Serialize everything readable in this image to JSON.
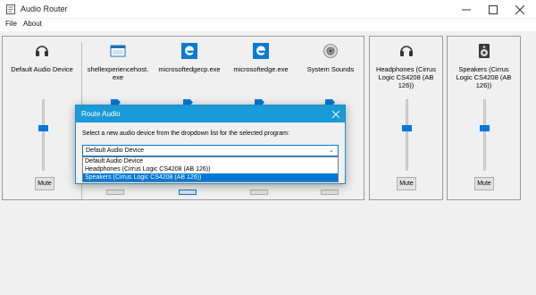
{
  "window": {
    "title": "Audio Router"
  },
  "menu": {
    "file": "File",
    "about": "About"
  },
  "main_device": {
    "label": "Default Audio Device",
    "icon": "headphones-icon",
    "mute_label": "Mute",
    "volume": 0.6
  },
  "programs": [
    {
      "label": "shellexperiencehost.\nexe",
      "icon": "window-app-icon"
    },
    {
      "label": "microsoftedgecp.exe",
      "icon": "edge-icon"
    },
    {
      "label": "microsoftedge.exe",
      "icon": "edge-icon"
    },
    {
      "label": "System Sounds",
      "icon": "speaker-icon"
    }
  ],
  "devices": [
    {
      "label": "Headphones (Cirrus\nLogic CS4208 (AB\n126))",
      "icon": "headphones-icon",
      "mute_label": "Mute",
      "volume": 0.6
    },
    {
      "label": "Speakers (Cirrus\nLogic CS4208 (AB\n126))",
      "icon": "speaker-icon",
      "mute_label": "Mute",
      "volume": 0.6
    }
  ],
  "dialog": {
    "title": "Route Audio",
    "message": "Select a new audio device from the dropdown list for the selected program:",
    "selected": "Default Audio Device",
    "options": [
      "Default Audio Device",
      "Headphones (Cirrus Logic CS4208 (AB 126))",
      "Speakers (Cirrus Logic CS4208 (AB 126))"
    ],
    "highlighted_index": 2
  },
  "colors": {
    "accent": "#0078d7",
    "dialog_title": "#1a9ad6"
  }
}
